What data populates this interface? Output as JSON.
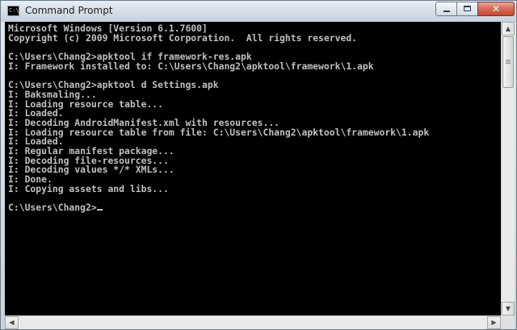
{
  "window": {
    "title": "Command Prompt",
    "icon_text": "C:\\.",
    "controls": {
      "close_glyph": "✕"
    }
  },
  "console": {
    "lines": [
      "Microsoft Windows [Version 6.1.7600]",
      "Copyright (c) 2009 Microsoft Corporation.  All rights reserved.",
      "",
      "C:\\Users\\Chang2>apktool if framework-res.apk",
      "I: Framework installed to: C:\\Users\\Chang2\\apktool\\framework\\1.apk",
      "",
      "C:\\Users\\Chang2>apktool d Settings.apk",
      "I: Baksmaling...",
      "I: Loading resource table...",
      "I: Loaded.",
      "I: Decoding AndroidManifest.xml with resources...",
      "I: Loading resource table from file: C:\\Users\\Chang2\\apktool\\framework\\1.apk",
      "I: Loaded.",
      "I: Regular manifest package...",
      "I: Decoding file-resources...",
      "I: Decoding values */* XMLs...",
      "I: Done.",
      "I: Copying assets and libs...",
      "",
      "C:\\Users\\Chang2>"
    ]
  },
  "scrollbars": {
    "up_arrow": "▲",
    "down_arrow": "▼",
    "left_arrow": "◀",
    "right_arrow": "▶"
  },
  "colors": {
    "console_bg": "#000000",
    "console_text": "#c0c0c0",
    "close_button": "#c44a33"
  }
}
